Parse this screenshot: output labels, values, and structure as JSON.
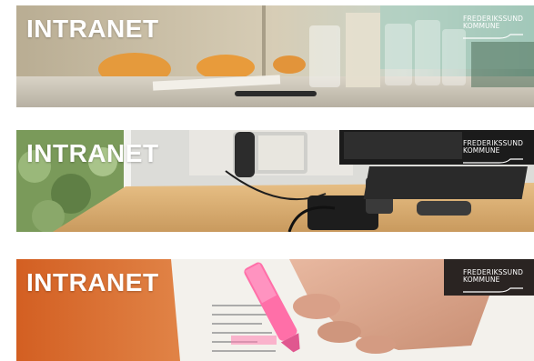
{
  "banners": [
    {
      "title": "INTRANET",
      "org_line1": "FREDERIKSSUND",
      "org_line2": "KOMMUNE",
      "scene": "meeting-room-glasses-scene",
      "accent": "#c8b89a"
    },
    {
      "title": "INTRANET",
      "org_line1": "FREDERIKSSUND",
      "org_line2": "KOMMUNE",
      "scene": "desk-phone-headset-scene",
      "accent": "#6a7a4a"
    },
    {
      "title": "INTRANET",
      "org_line1": "FREDERIKSSUND",
      "org_line2": "KOMMUNE",
      "scene": "highlighter-hand-scene",
      "accent": "#d2692e"
    }
  ]
}
